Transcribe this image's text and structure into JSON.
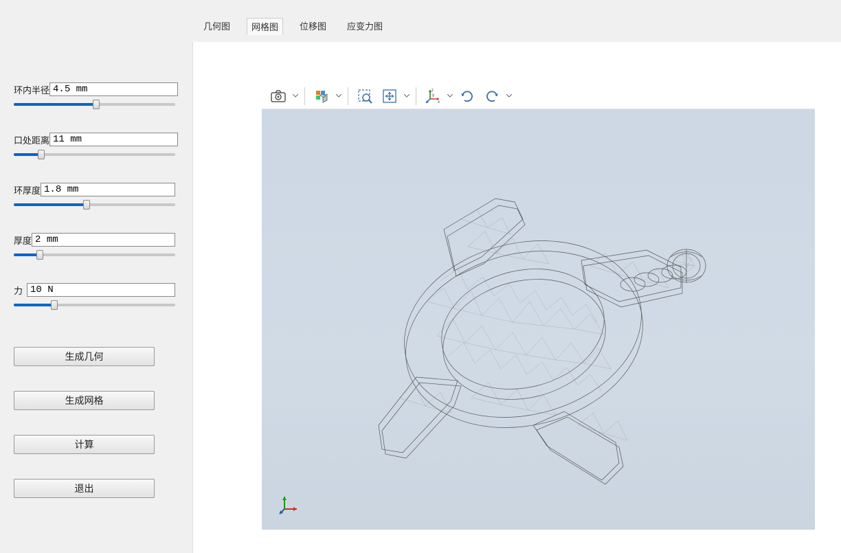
{
  "params": {
    "inner_radius": {
      "label": "环内半径",
      "value": "4.5 mm",
      "fill_pct": 51
    },
    "gap_distance": {
      "label": "口处距离",
      "value": "11 mm",
      "fill_pct": 17
    },
    "ring_thickness": {
      "label": "环厚度",
      "value": "1.8 mm",
      "fill_pct": 45
    },
    "thickness": {
      "label": "厚度",
      "value": "2 mm",
      "fill_pct": 16
    },
    "force": {
      "label": "力",
      "value": "10 N",
      "fill_pct": 25
    }
  },
  "buttons": {
    "gen_geometry": "生成几何",
    "gen_mesh": "生成网格",
    "compute": "计算",
    "exit": "退出"
  },
  "tabs": {
    "geometry": "几何图",
    "mesh": "网格图",
    "displacement": "位移图",
    "stress": "应变力图",
    "active": "mesh"
  },
  "toolbar": {
    "screenshot": "screenshot-icon",
    "render_mode": "render-mode-icon",
    "zoom_select": "zoom-select-icon",
    "zoom_fit": "zoom-fit-icon",
    "axis_xyz": "axis-xyz-icon",
    "rotate_ccw": "rotate-ccw-icon",
    "rotate_cw": "rotate-cw-icon"
  },
  "axis_labels": {
    "x": "x",
    "y": "y",
    "z": "z"
  },
  "colors": {
    "accent": "#0066cc",
    "viewer_bg_top": "#ccd7e4",
    "viewer_bg_bottom": "#cbd5e0"
  }
}
